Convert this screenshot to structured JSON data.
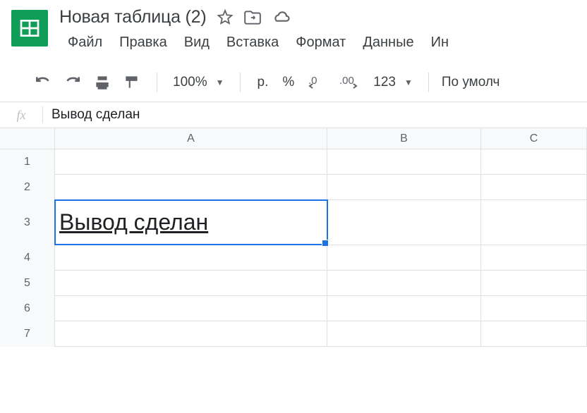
{
  "doc": {
    "title": "Новая таблица (2)"
  },
  "menu": {
    "file": "Файл",
    "edit": "Правка",
    "view": "Вид",
    "insert": "Вставка",
    "format": "Формат",
    "data": "Данные",
    "more": "Ин"
  },
  "toolbar": {
    "zoom": "100%",
    "currency": "р.",
    "percent": "%",
    "dec_dec": ".0",
    "dec_inc": ".00",
    "numformat": "123",
    "font": "По умолч"
  },
  "formula": {
    "fx": "fx",
    "value": "Вывод сделан"
  },
  "columns": {
    "a": "A",
    "b": "B",
    "c": "C"
  },
  "rows": {
    "r1": "1",
    "r2": "2",
    "r3": "3",
    "r4": "4",
    "r5": "5",
    "r6": "6",
    "r7": "7"
  },
  "cells": {
    "a3": "Вывод сделан"
  }
}
